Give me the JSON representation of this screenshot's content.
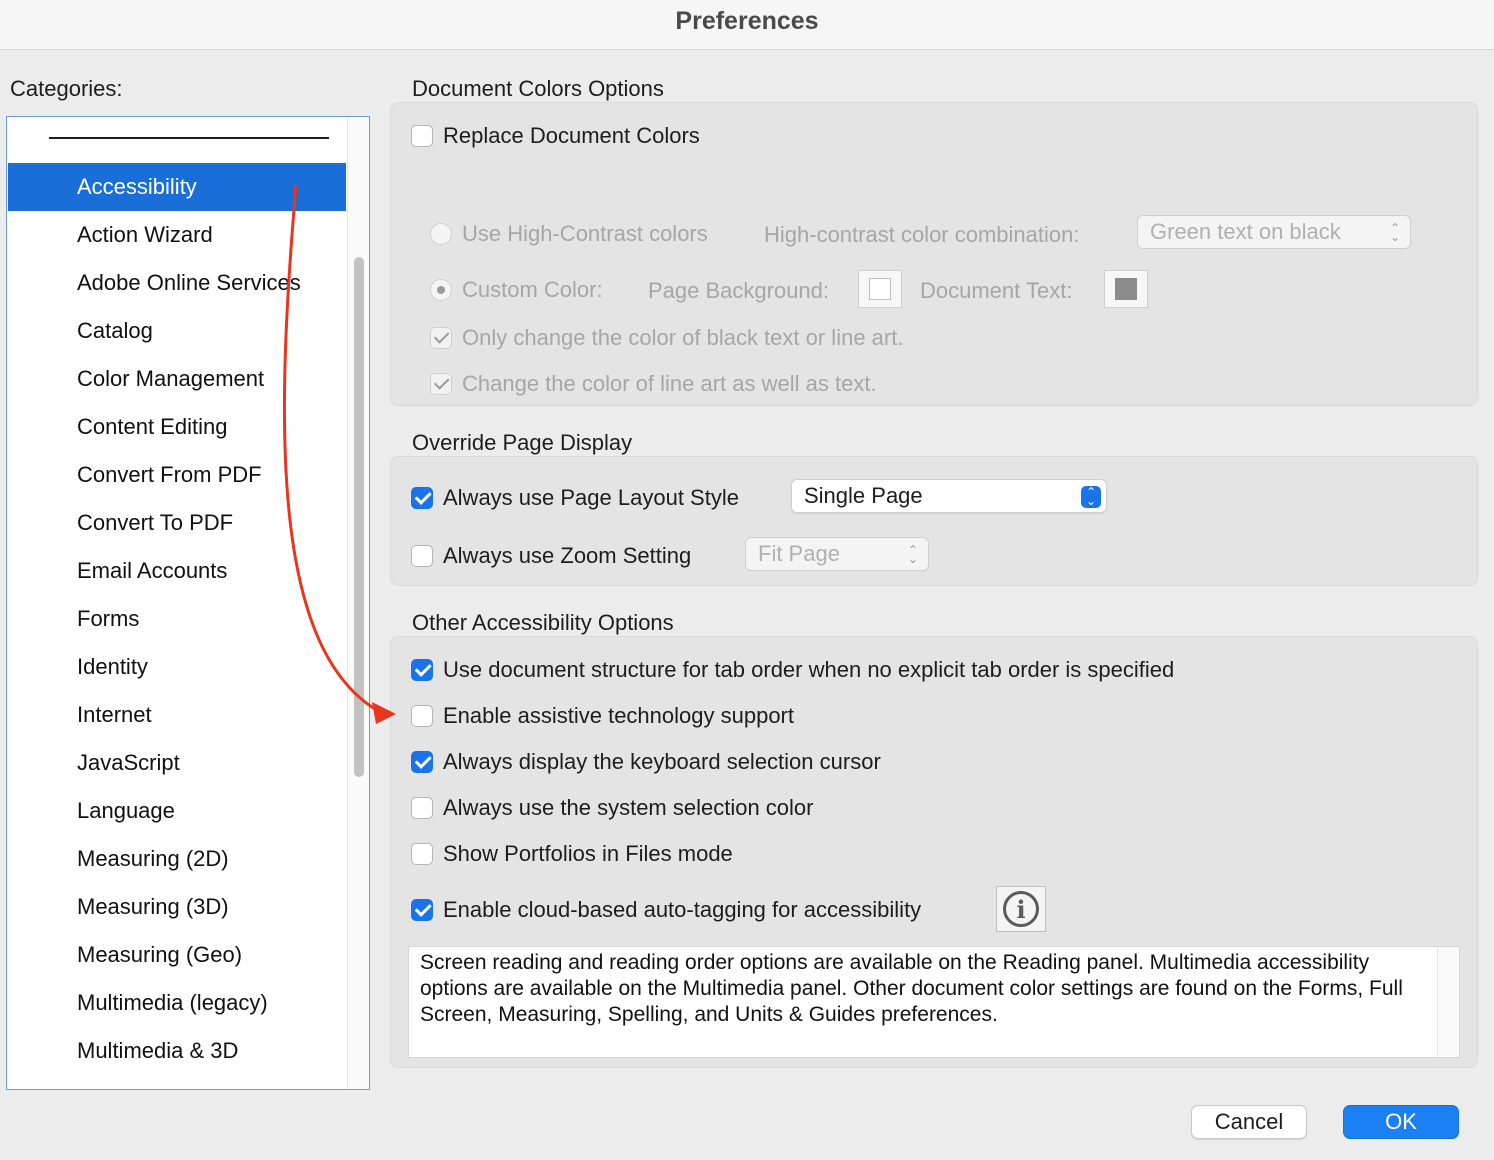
{
  "window": {
    "title": "Preferences"
  },
  "categories": {
    "label": "Categories:",
    "items": [
      {
        "label": "Accessibility",
        "selected": true
      },
      {
        "label": "Action Wizard"
      },
      {
        "label": "Adobe Online Services"
      },
      {
        "label": "Catalog"
      },
      {
        "label": "Color Management"
      },
      {
        "label": "Content Editing"
      },
      {
        "label": "Convert From PDF"
      },
      {
        "label": "Convert To PDF"
      },
      {
        "label": "Email Accounts"
      },
      {
        "label": "Forms"
      },
      {
        "label": "Identity"
      },
      {
        "label": "Internet"
      },
      {
        "label": "JavaScript"
      },
      {
        "label": "Language"
      },
      {
        "label": "Measuring (2D)"
      },
      {
        "label": "Measuring (3D)"
      },
      {
        "label": "Measuring (Geo)"
      },
      {
        "label": "Multimedia (legacy)"
      },
      {
        "label": "Multimedia & 3D"
      }
    ]
  },
  "doc_colors": {
    "title": "Document Colors Options",
    "replace": {
      "label": "Replace Document Colors",
      "checked": false
    },
    "high_contrast": {
      "label": "Use High-Contrast colors",
      "selected": false
    },
    "combo_label": "High-contrast color combination:",
    "combo_value": "Green text on black",
    "custom": {
      "label": "Custom Color:",
      "selected": true
    },
    "page_bg_label": "Page Background:",
    "page_bg_color": "#ffffff",
    "doc_text_label": "Document Text:",
    "doc_text_color": "#8c8c8c",
    "only_black": {
      "label": "Only change the color of black text or line art.",
      "checked": true
    },
    "line_art": {
      "label": "Change the color of line art as well as text.",
      "checked": true
    }
  },
  "override": {
    "title": "Override Page Display",
    "layout": {
      "label": "Always use Page Layout Style",
      "checked": true,
      "value": "Single Page"
    },
    "zoom": {
      "label": "Always use Zoom Setting",
      "checked": false,
      "value": "Fit Page"
    }
  },
  "other": {
    "title": "Other Accessibility Options",
    "options": [
      {
        "label": "Use document structure for tab order when no explicit tab order is specified",
        "checked": true
      },
      {
        "label": "Enable assistive technology support",
        "checked": false
      },
      {
        "label": "Always display the keyboard selection cursor",
        "checked": true
      },
      {
        "label": "Always use the system selection color",
        "checked": false
      },
      {
        "label": "Show Portfolios in Files mode",
        "checked": false
      },
      {
        "label": "Enable cloud-based auto-tagging for accessibility",
        "checked": true
      }
    ],
    "info_icon": "info-icon",
    "note": "Screen reading and reading order options are available on the Reading panel. Multimedia accessibility options are available on the Multimedia panel. Other document color settings are found on the Forms, Full Screen, Measuring, Spelling, and Units & Guides preferences."
  },
  "buttons": {
    "cancel": "Cancel",
    "ok": "OK"
  },
  "colors": {
    "accent": "#1a73e8",
    "selection": "#1a6ed8",
    "annotation_arrow": "#e8361e"
  }
}
